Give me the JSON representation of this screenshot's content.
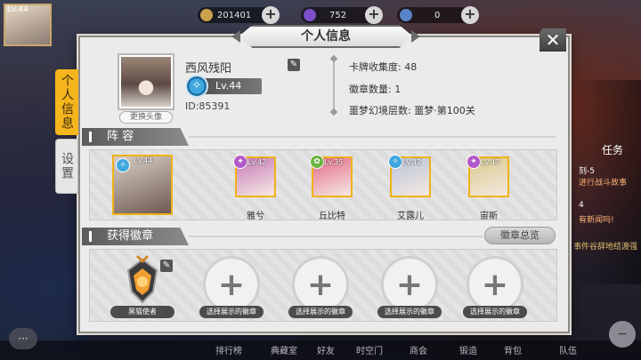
{
  "topbar": {
    "level": "Lv.44",
    "gold": "201401",
    "gems": "752",
    "stamina": "0"
  },
  "dialog": {
    "title": "个人信息",
    "close_label": "✕"
  },
  "tabs": {
    "active": "个人信息",
    "inactive": "设置"
  },
  "profile": {
    "name": "西风残阳",
    "level": "Lv.44",
    "id": "ID:85391",
    "change_avatar": "更换头像",
    "stats": [
      "卡牌收集度: 48",
      "徽章数量: 1",
      "噩梦幻境层数: 噩梦·第100关"
    ]
  },
  "lineup": {
    "header": "阵 容",
    "main_level": "Lv.44",
    "cards": [
      {
        "name": "雅兮",
        "level": "Lv.42",
        "color": "#c77ab8"
      },
      {
        "name": "丘比特",
        "level": "Lv.35",
        "color": "#e46a86"
      },
      {
        "name": "艾露儿",
        "level": "Lv.42",
        "color": "#b9c3d6"
      },
      {
        "name": "宙斯",
        "level": "Lv.43",
        "color": "#d9c98a"
      }
    ]
  },
  "badges": {
    "header": "获得徽章",
    "overview_button": "徽章总览",
    "owned": "黑猫使者",
    "slots": [
      "选择展示的徽章",
      "选择展示的徽章",
      "选择展示的徽章",
      "选择展示的徽章"
    ]
  },
  "background": {
    "side_texts": [
      "任务",
      "刻-5",
      "进行战斗故事",
      "4",
      "有新闻吗!",
      "事件谷辞地结渡强"
    ],
    "bottom_nav": [
      "排行榜",
      "典藏室",
      "好友",
      "时空门",
      "商会",
      "锻造",
      "背包",
      "队伍"
    ]
  }
}
